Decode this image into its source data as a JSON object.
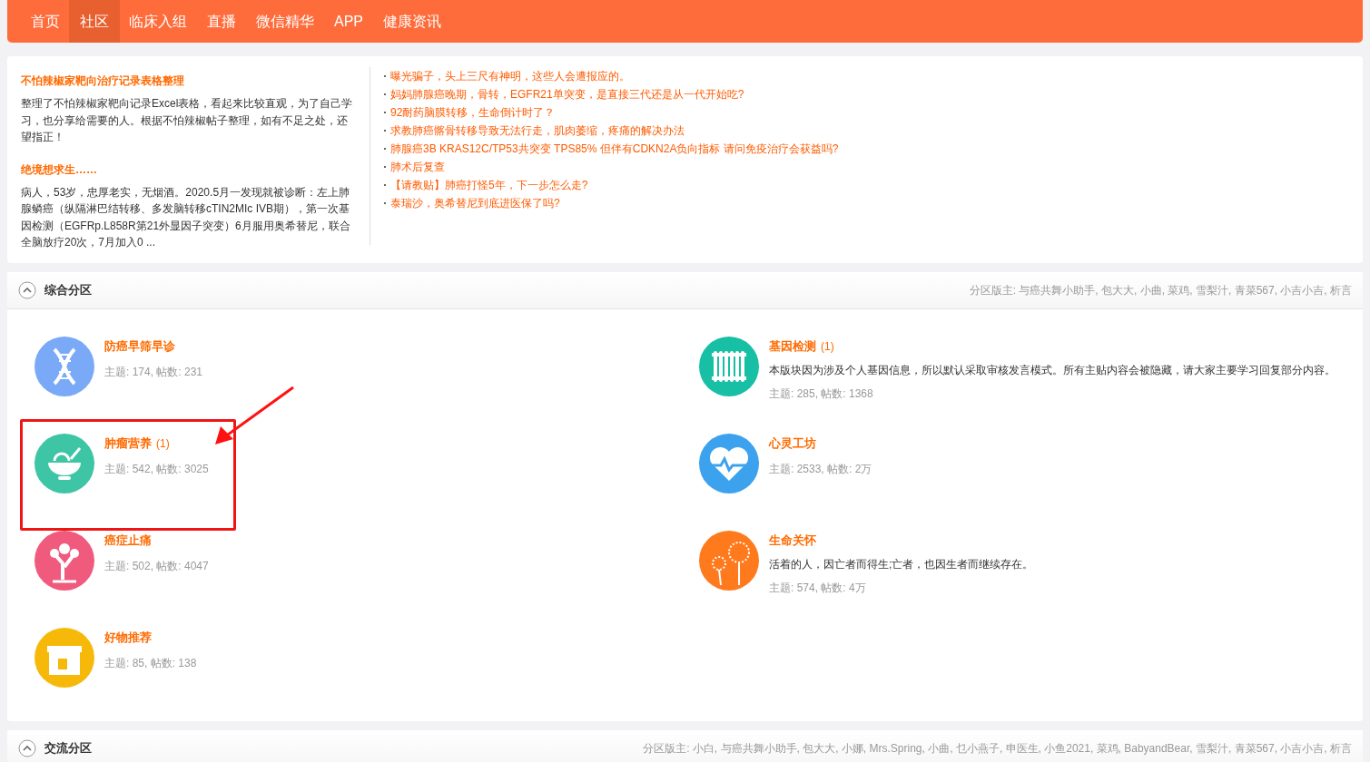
{
  "nav": [
    {
      "label": "首页",
      "selected": false
    },
    {
      "label": "社区",
      "selected": true
    },
    {
      "label": "临床入组",
      "selected": false
    },
    {
      "label": "直播",
      "selected": false
    },
    {
      "label": "微信精华",
      "selected": false
    },
    {
      "label": "APP",
      "selected": false
    },
    {
      "label": "健康资讯",
      "selected": false
    }
  ],
  "featured": [
    {
      "title": "不怕辣椒家靶向治疗记录表格整理",
      "summary": "整理了不怕辣椒家靶向记录Excel表格，看起来比较直观，为了自己学习，也分享给需要的人。根据不怕辣椒帖子整理，如有不足之处，还望指正！"
    },
    {
      "title": "绝境想求生……",
      "summary": "病人，53岁，忠厚老实，无烟酒。2020.5月一发现就被诊断：左上肺腺鳞癌（纵隔淋巴结转移、多发脑转移cTIN2MIc IVB期），第一次基因检测（EGFRp.L858R第21外显因子突变）6月服用奥希替尼，联合全脑放疗20次，7月加入0 ..."
    }
  ],
  "latest_threads": [
    "曝光骗子，头上三尺有神明，这些人会遭报应的。",
    "妈妈肺腺癌晚期，骨转，EGFR21单突变，是直接三代还是从一代开始吃?",
    "92耐药脑膜转移，生命倒计时了？",
    "求教肺癌髂骨转移导致无法行走，肌肉萎缩，疼痛的解决办法",
    "肺腺癌3B KRAS12C/TP53共突变 TPS85% 但伴有CDKN2A负向指标 请问免疫治疗会获益吗?",
    "肺术后复查",
    "【请教贴】肺癌打怪5年，下一步怎么走?",
    "泰瑞沙，奥希替尼到底进医保了吗?"
  ],
  "sections": [
    {
      "title": "综合分区",
      "expanded": true,
      "moderators": "分区版主: 与癌共舞小助手, 包大大, 小曲, 菜鸡, 雪梨汁, 青菜567, 小吉小吉, 析言",
      "forums": [
        {
          "name": "防癌早筛早诊",
          "kind": "dna",
          "color": "#7aa9f7",
          "stats": "主题: 174, 帖数: 231",
          "highlighted": false
        },
        {
          "name": "基因检测",
          "new_count": "(1)",
          "kind": "tubes",
          "color": "#17bfa5",
          "description": "本版块因为涉及个人基因信息，所以默认采取审核发言模式。所有主贴内容会被隐藏，请大家主要学习回复部分内容。",
          "stats": "主题: 285, 帖数: 1368",
          "highlighted": false
        },
        {
          "name": "肿瘤营养",
          "new_count": "(1)",
          "kind": "bowl",
          "color": "#3ec5a5",
          "stats": "主题: 542, 帖数: 3025",
          "highlighted": true
        },
        {
          "name": "心灵工坊",
          "kind": "heart",
          "color": "#3da2ee",
          "stats": "主题: 2533, 帖数: 2万",
          "highlighted": false
        },
        {
          "name": "癌症止痛",
          "kind": "tree",
          "color": "#f05a7c",
          "stats": "主题: 502, 帖数: 4047",
          "highlighted": false
        },
        {
          "name": "生命关怀",
          "kind": "dandelion",
          "color": "#ff7a1c",
          "description": "活着的人，因亡者而得生;亡者，也因生者而继续存在。",
          "stats": "主题: 574, 帖数: 4万",
          "highlighted": false
        },
        {
          "name": "好物推荐",
          "kind": "gift",
          "color": "#f6b90a",
          "stats": "主题: 85, 帖数: 138",
          "highlighted": false
        }
      ]
    },
    {
      "title": "交流分区",
      "expanded": true,
      "moderators": "分区版主: 小白, 与癌共舞小助手, 包大大, 小娜, Mrs.Spring, 小曲, 乜小燕子, 申医生, 小鱼2021, 菜鸡, BabyandBear, 雪梨汁, 青菜567, 小吉小吉, 析言"
    }
  ]
}
